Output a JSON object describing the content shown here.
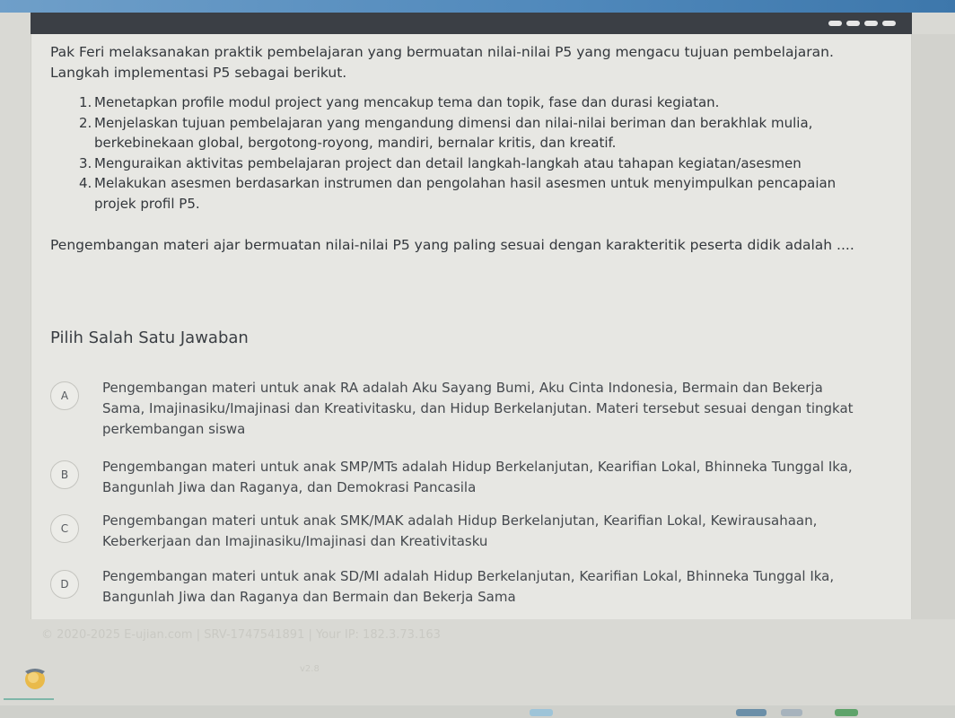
{
  "question": {
    "intro": "Pak Feri melaksanakan praktik pembelajaran yang bermuatan nilai-nilai P5 yang mengacu tujuan pembelajaran. Langkah implementasi P5 sebagai berikut.",
    "steps": [
      {
        "num": "1.",
        "text": "Menetapkan profile modul project yang mencakup tema dan topik, fase dan durasi kegiatan."
      },
      {
        "num": "2.",
        "text": "Menjelaskan tujuan pembelajaran yang mengandung dimensi dan nilai-nilai beriman dan berakhlak mulia, berkebinekaan global, bergotong-royong, mandiri, bernalar kritis, dan kreatif."
      },
      {
        "num": "3.",
        "text": "Menguraikan aktivitas pembelajaran project dan detail langkah-langkah atau tahapan kegiatan/asesmen"
      },
      {
        "num": "4.",
        "text": "Melakukan asesmen berdasarkan instrumen dan pengolahan hasil asesmen untuk menyimpulkan pencapaian projek profil P5."
      }
    ],
    "prompt": "Pengembangan materi ajar bermuatan nilai-nilai P5 yang paling sesuai dengan karakteritik peserta didik adalah ...."
  },
  "answers": {
    "heading": "Pilih Salah Satu Jawaban",
    "options": [
      {
        "letter": "A",
        "text": "Pengembangan materi untuk anak RA adalah Aku Sayang Bumi, Aku Cinta Indonesia, Bermain dan Bekerja Sama, Imajinasiku/Imajinasi dan Kreativitasku, dan Hidup Berkelanjutan. Materi tersebut sesuai dengan tingkat perkembangan siswa"
      },
      {
        "letter": "B",
        "text": "Pengembangan materi untuk anak SMP/MTs adalah Hidup Berkelanjutan, Kearifian Lokal, Bhinneka Tunggal Ika, Bangunlah Jiwa dan Raganya, dan Demokrasi Pancasila"
      },
      {
        "letter": "C",
        "text": "Pengembangan materi untuk anak SMK/MAK adalah Hidup Berkelanjutan, Kearifian Lokal, Kewirausahaan, Keberkerjaan dan Imajinasiku/Imajinasi dan Kreativitasku"
      },
      {
        "letter": "D",
        "text": "Pengembangan materi untuk anak SD/MI adalah Hidup Berkelanjutan, Kearifian Lokal, Bhinneka Tunggal Ika, Bangunlah Jiwa dan Raganya dan Bermain dan Bekerja Sama"
      }
    ]
  },
  "footer": {
    "text": "© 2020-2025 E-ujian.com | SRV-1747541891 | Your IP: 182.3.73.163",
    "small": "v2.8"
  },
  "icons": {
    "brand": "brand-logo-icon"
  }
}
